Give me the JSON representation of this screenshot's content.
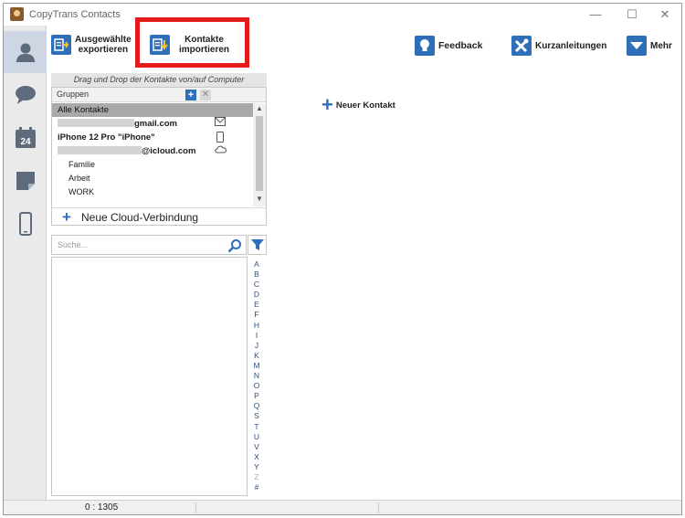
{
  "window": {
    "title": "CopyTrans Contacts",
    "min": "—",
    "max": "☐",
    "close": "✕"
  },
  "toolbar": {
    "export_label_1": "Ausgewählte",
    "export_label_2": "exportieren",
    "import_label_1": "Kontakte",
    "import_label_2": "importieren",
    "feedback_label": "Feedback",
    "guides_label": "Kurzanleitungen",
    "more_label": "Mehr",
    "highlight_color": "#e31b1b",
    "accent_color": "#2f6fba"
  },
  "nav": {
    "items": [
      {
        "icon": "contacts-icon",
        "active": true
      },
      {
        "icon": "messages-icon",
        "active": false
      },
      {
        "icon": "calendar-icon",
        "label": "24",
        "active": false
      },
      {
        "icon": "notes-icon",
        "active": false
      },
      {
        "icon": "phone-icon",
        "active": false
      }
    ]
  },
  "drag_hint": "Drag und Drop der Kontakte von/auf Computer",
  "groups": {
    "header": "Gruppen",
    "add": "+",
    "delete": "✕",
    "rows": [
      {
        "label": "Alle Kontakte"
      },
      {
        "label": "gmail.com"
      },
      {
        "label": "iPhone 12 Pro \"iPhone\""
      },
      {
        "label": "@icloud.com"
      },
      {
        "label": "Familie"
      },
      {
        "label": "Arbeit"
      },
      {
        "label": "WORK"
      }
    ],
    "cloud_label": "Neue Cloud-Verbindung"
  },
  "search": {
    "placeholder": "Suche..."
  },
  "alphabet": [
    "A",
    "B",
    "C",
    "D",
    "E",
    "F",
    "H",
    "I",
    "J",
    "K",
    "M",
    "N",
    "O",
    "P",
    "Q",
    "S",
    "T",
    "U",
    "V",
    "X",
    "Y",
    "Z",
    "#"
  ],
  "main": {
    "new_contact_label": "Neuer Kontakt"
  },
  "status": {
    "count": "0 : 1305"
  }
}
